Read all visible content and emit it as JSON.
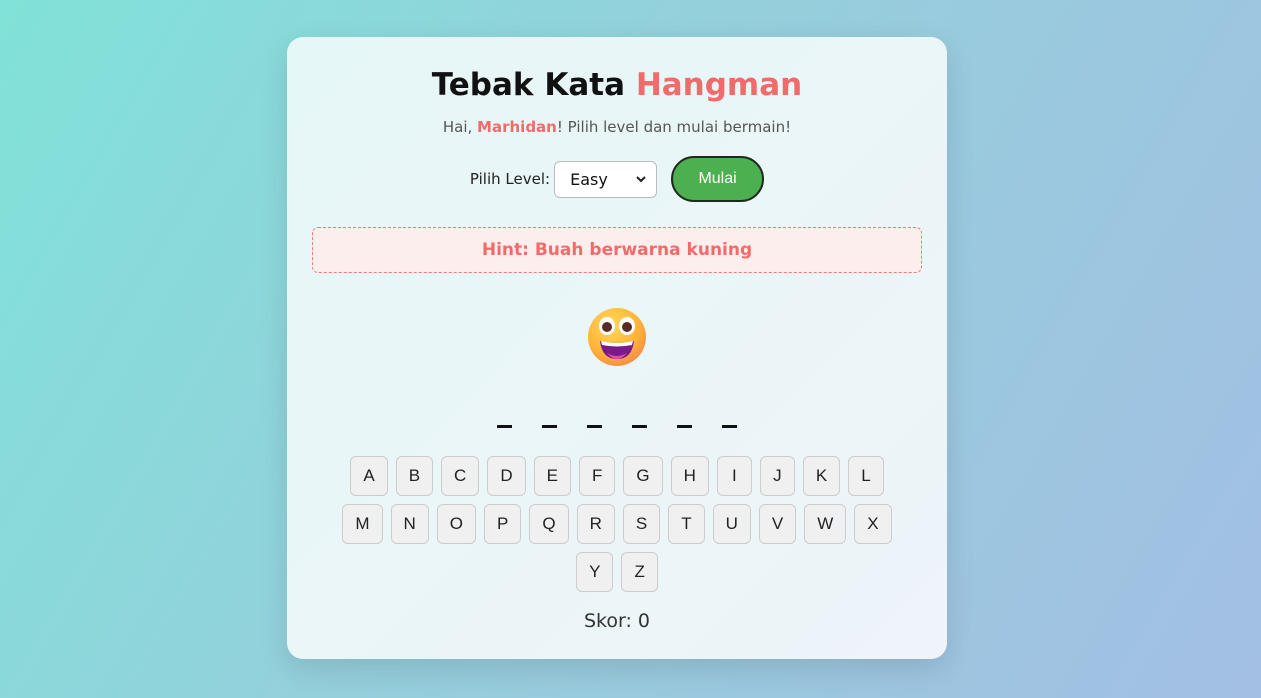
{
  "title": {
    "main": "Tebak Kata",
    "accent": "Hangman"
  },
  "greeting": {
    "prefix": "Hai, ",
    "name": "Marhidan",
    "suffix": "! Pilih level dan mulai bermain!"
  },
  "level": {
    "label": "Pilih Level:",
    "selected": "Easy"
  },
  "start_button": "Mulai",
  "hint": "Hint: Buah berwarna kuning",
  "word_blanks": 6,
  "keyboard": {
    "row1": [
      "A",
      "B",
      "C",
      "D",
      "E",
      "F",
      "G",
      "H",
      "I",
      "J",
      "K",
      "L"
    ],
    "row2": [
      "M",
      "N",
      "O",
      "P",
      "Q",
      "R",
      "S",
      "T",
      "U",
      "V",
      "W",
      "X"
    ],
    "row3": [
      "Y",
      "Z"
    ]
  },
  "score": "Skor: 0",
  "colors": {
    "accent": "#f26b6b",
    "start_button": "#4caf50",
    "hint_bg": "#fdeeee"
  },
  "status_icon": "grinning-face-emoji"
}
